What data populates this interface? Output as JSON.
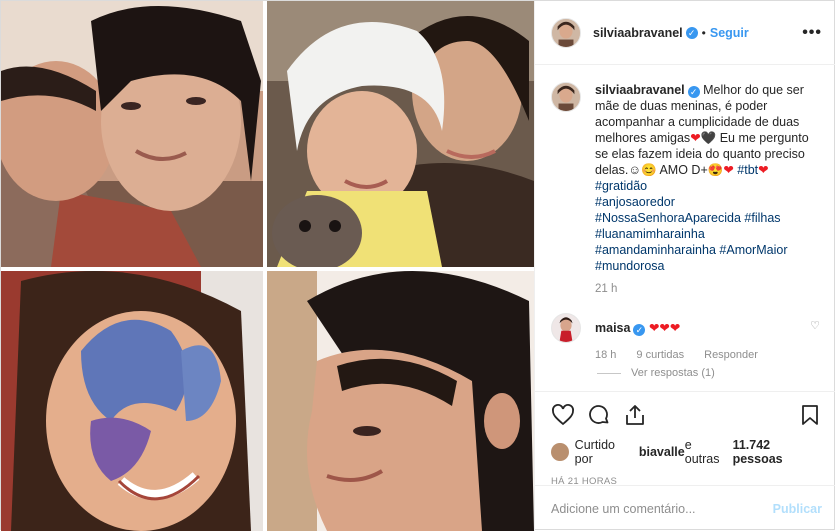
{
  "post": {
    "username": "silviaabravanel",
    "verified_mark": "✓",
    "separator": "•",
    "follow_label": "Seguir",
    "more_label": "•••",
    "caption": {
      "line_a": "Melhor do que ser mãe de duas meninas, é poder acompanhar a cumplicidade de duas melhores amigas",
      "hearts_a": "❤🖤",
      "line_b": " Eu me pergunto se elas fazem ideia do quanto preciso delas.",
      "emoji_b": "☺😊",
      "amo": " AMO D+",
      "emoji_c": "😍❤",
      "tags": [
        "#tbt",
        "#gratidão",
        "#anjosaoredor",
        "#NossaSenhoraAparecida",
        "#filhas",
        "#luanamimharainha",
        "#amandaminharainha",
        "#AmorMaior",
        "#mundorosa"
      ],
      "tbt_heart": "❤",
      "time": "21 h"
    },
    "comment": {
      "username": "maisa",
      "verified_mark": "✓",
      "text": "❤❤❤",
      "time": "18 h",
      "likes": "9 curtidas",
      "reply": "Responder",
      "see_replies": "Ver respostas (1)",
      "heart_icon": "♡"
    },
    "likes": {
      "prefix": "Curtido por ",
      "user": "biavalle",
      "middle": " e outras ",
      "count": "11.742 pessoas"
    },
    "time_ago": "HÁ 21 HORAS",
    "add_comment_placeholder": "Adicione um comentário...",
    "publish_label": "Publicar",
    "icons": [
      "heart-icon",
      "comment-icon",
      "share-icon",
      "bookmark-icon"
    ]
  }
}
